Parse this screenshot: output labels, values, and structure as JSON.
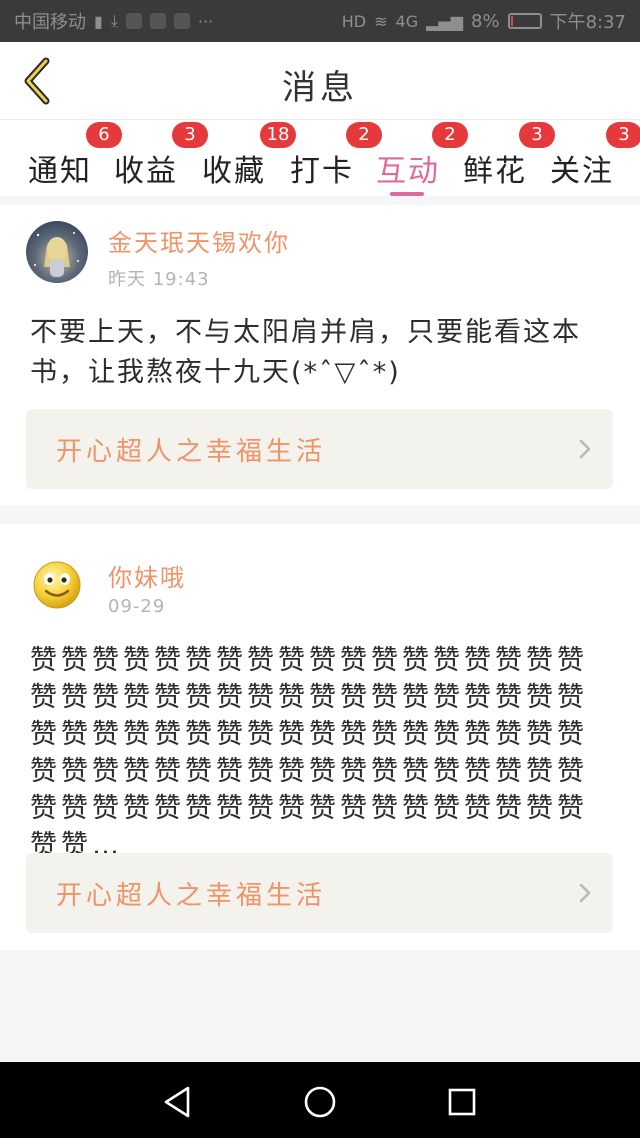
{
  "status_bar": {
    "carrier": "中国移动",
    "network": "4G",
    "battery_pct": "8%",
    "time": "下午8:37",
    "battery_level": 0.08
  },
  "header": {
    "title": "消息",
    "back_icon": "chevron-left-icon"
  },
  "tabs": [
    {
      "label": "通知",
      "badge": "6"
    },
    {
      "label": "收益",
      "badge": "3"
    },
    {
      "label": "收藏",
      "badge": "18"
    },
    {
      "label": "打卡",
      "badge": "2"
    },
    {
      "label": "互动",
      "badge": "2",
      "active": true
    },
    {
      "label": "鲜花",
      "badge": "3"
    },
    {
      "label": "关注",
      "badge": "3"
    }
  ],
  "accent_color": "#e0699b",
  "name_color": "#ef9468",
  "badge_color": "#e5393c",
  "messages": [
    {
      "user": "金天珉天锡欢你",
      "time": "昨天  19:43",
      "text": "不要上天，不与太阳肩并肩，只要能看这本书，让我熬夜十九天(*ˆ▽ˆ*)",
      "book": "开心超人之幸福生活"
    },
    {
      "user": "你妹哦",
      "time": "09-29",
      "text": "赞赞赞赞赞赞赞赞赞赞赞赞赞赞赞赞赞赞赞赞赞赞赞赞赞赞赞赞赞赞赞赞赞赞赞赞赞赞赞赞赞赞赞赞赞赞赞赞赞赞赞赞赞赞赞赞赞赞赞赞赞赞赞赞赞赞赞赞赞赞赞赞赞赞赞赞赞赞赞赞赞赞赞赞赞赞赞赞赞赞赞赞…",
      "book": "开心超人之幸福生活"
    }
  ]
}
